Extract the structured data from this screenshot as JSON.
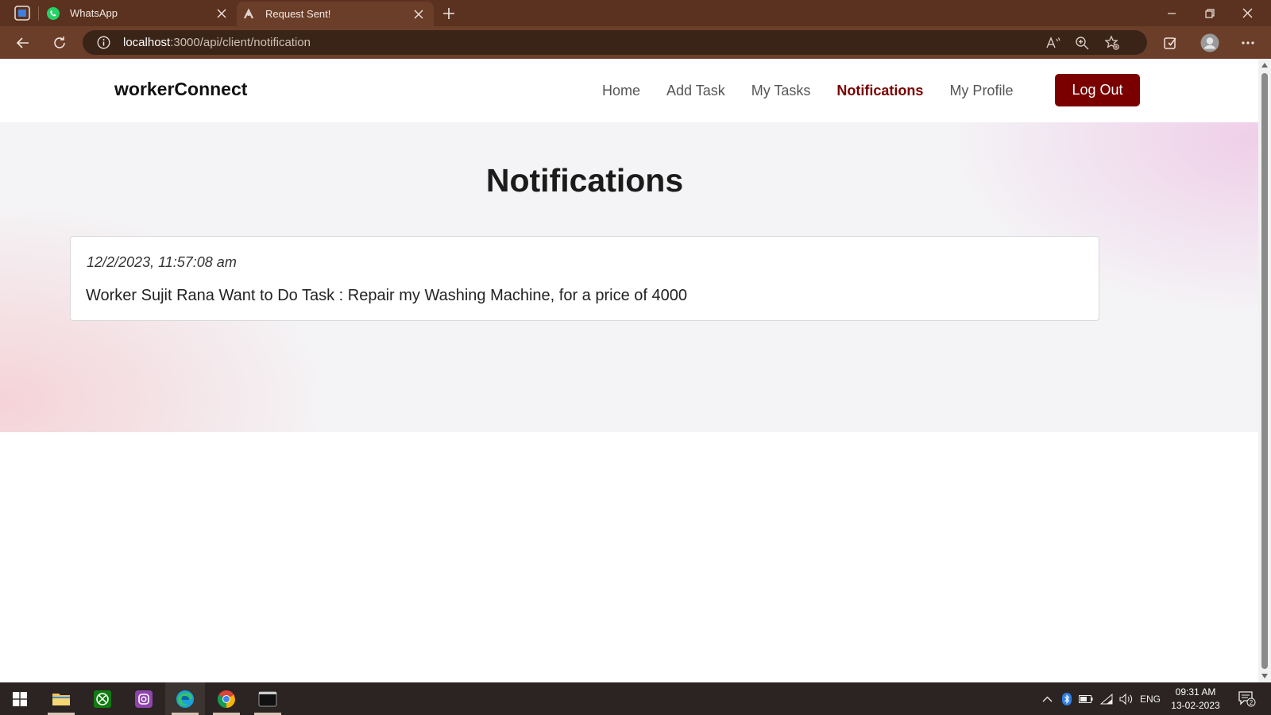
{
  "browser": {
    "tabs": [
      {
        "label": "WhatsApp",
        "icon": "whatsapp-icon"
      },
      {
        "label": "Request Sent!",
        "icon": "site-favicon"
      }
    ],
    "url_host": "localhost",
    "url_path": ":3000/api/client/notification"
  },
  "site": {
    "brand": "workerConnect",
    "nav": {
      "home": "Home",
      "add_task": "Add Task",
      "my_tasks": "My Tasks",
      "notifications": "Notifications",
      "my_profile": "My Profile"
    },
    "logout": "Log Out",
    "accent_color": "#7a0000"
  },
  "page": {
    "title": "Notifications",
    "notifications": [
      {
        "time": "12/2/2023, 11:57:08 am",
        "message": "Worker Sujit Rana Want to Do Task : Repair my Washing Machine, for a price of 4000"
      }
    ]
  },
  "taskbar": {
    "language": "ENG",
    "time": "09:31 AM",
    "date": "13-02-2023",
    "notification_count": "2"
  }
}
